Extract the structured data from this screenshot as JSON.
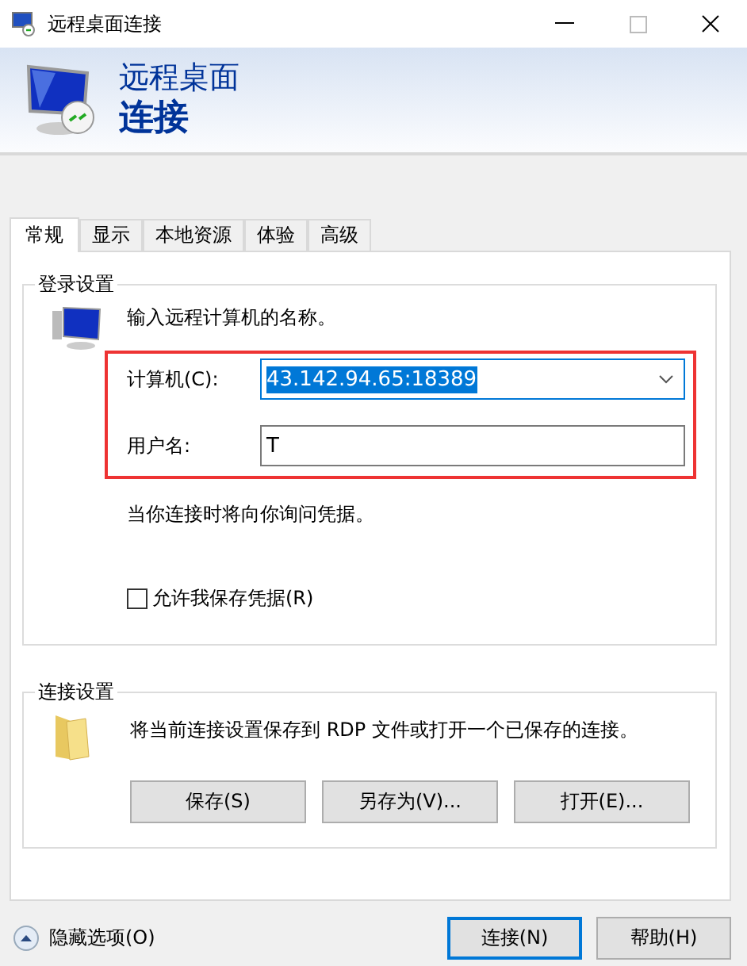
{
  "window": {
    "title": "远程桌面连接"
  },
  "header": {
    "line1": "远程桌面",
    "line2": "连接"
  },
  "tabs": [
    {
      "label": "常规",
      "selected": true
    },
    {
      "label": "显示",
      "selected": false
    },
    {
      "label": "本地资源",
      "selected": false
    },
    {
      "label": "体验",
      "selected": false
    },
    {
      "label": "高级",
      "selected": false
    }
  ],
  "login_settings": {
    "title": "登录设置",
    "description": "输入远程计算机的名称。",
    "highlighted": true,
    "computer": {
      "label": "计算机(C):",
      "value": "43.142.94.65:18389",
      "selected": true
    },
    "username": {
      "label": "用户名:",
      "value": "T"
    },
    "note": "当你连接时将向你询问凭据。",
    "save_credentials": {
      "label": "允许我保存凭据(R)",
      "checked": false
    }
  },
  "connection_settings": {
    "title": "连接设置",
    "description": "将当前连接设置保存到 RDP 文件或打开一个已保存的连接。",
    "buttons": [
      "保存(S)",
      "另存为(V)...",
      "打开(E)..."
    ]
  },
  "footer": {
    "toggle": "隐藏选项(O)",
    "buttons": [
      {
        "label": "连接(N)",
        "default": true
      },
      {
        "label": "帮助(H)",
        "default": false
      }
    ]
  }
}
